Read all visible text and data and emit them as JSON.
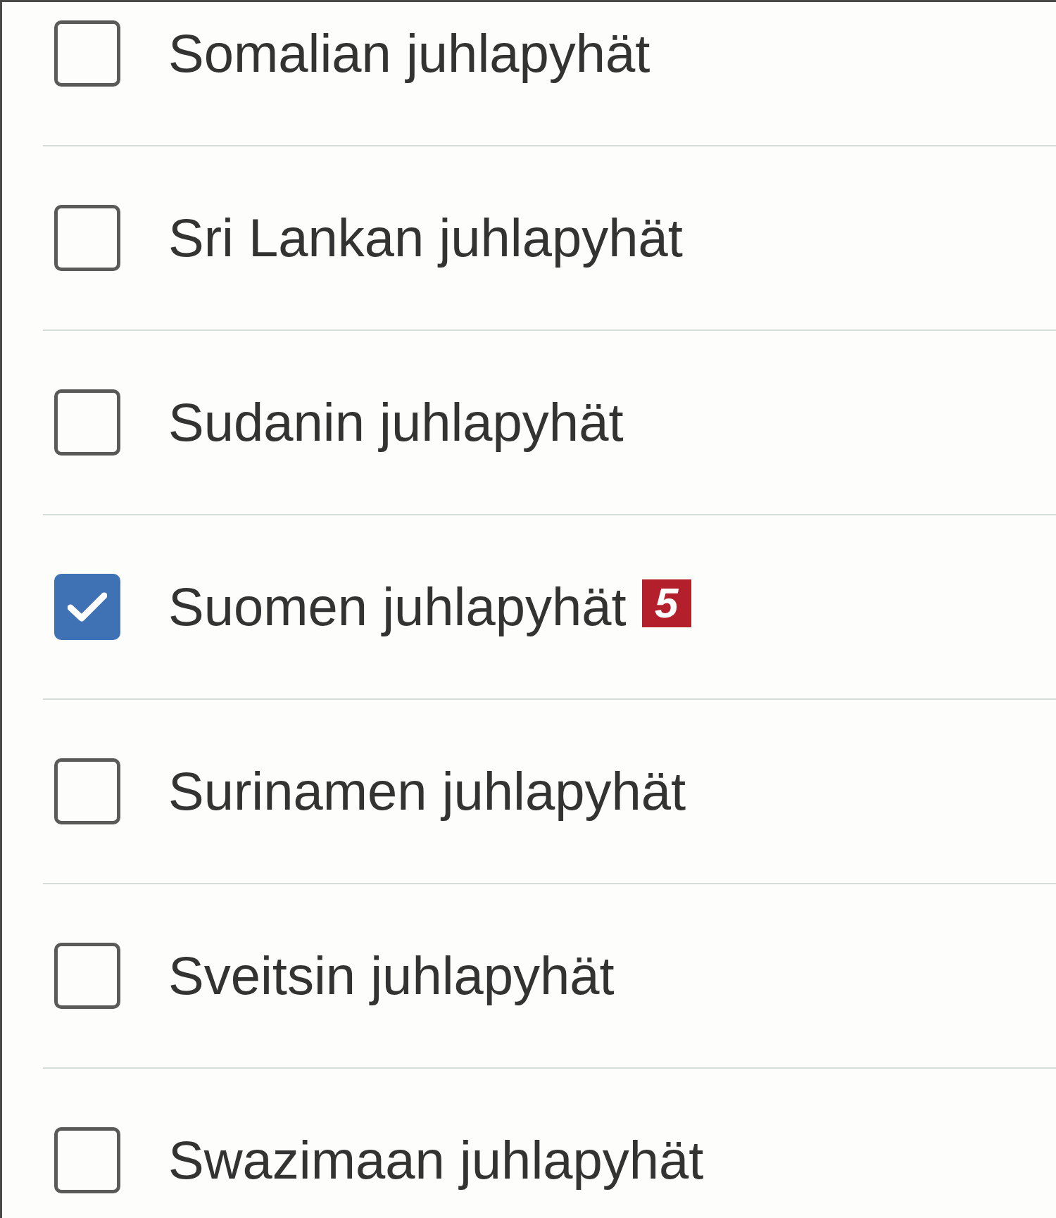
{
  "items": [
    {
      "label": "Somalian juhlapyhät",
      "checked": false
    },
    {
      "label": "Sri Lankan juhlapyhät",
      "checked": false
    },
    {
      "label": "Sudanin juhlapyhät",
      "checked": false
    },
    {
      "label": "Suomen juhlapyhät",
      "checked": true,
      "badge": "5"
    },
    {
      "label": "Surinamen juhlapyhät",
      "checked": false
    },
    {
      "label": "Sveitsin juhlapyhät",
      "checked": false
    },
    {
      "label": "Swazimaan juhlapyhät",
      "checked": false
    }
  ]
}
